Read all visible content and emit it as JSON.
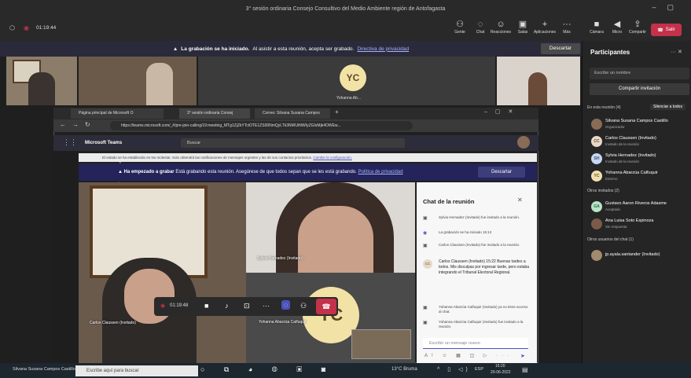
{
  "outer": {
    "window_title": "3° sesión ordinaria Consejo Consultivo del Medio Ambiente región de Antofagasta",
    "timer": "01:19:44",
    "toolbar": [
      {
        "label": "Gente",
        "icon": "people-icon"
      },
      {
        "label": "Chat",
        "icon": "chat-icon"
      },
      {
        "label": "Reacciones",
        "icon": "reactions-icon"
      },
      {
        "label": "Salas",
        "icon": "rooms-icon"
      },
      {
        "label": "Aplicaciones",
        "icon": "apps-icon"
      },
      {
        "label": "Más",
        "icon": "more-icon"
      }
    ],
    "device_controls": [
      {
        "label": "Cámara",
        "icon": "camera-icon"
      },
      {
        "label": "Micro",
        "icon": "mic-icon"
      },
      {
        "label": "Compartir",
        "icon": "share-icon"
      }
    ],
    "leave_label": "Salir",
    "rec_banner": {
      "text": "La grabación se ha iniciado.",
      "detail": "Al asistir a esta reunión, acepta ser grabado.",
      "link": "Directiva de privacidad",
      "button": "Descartar"
    },
    "thumbs": [
      {
        "name": ""
      },
      {
        "name": ""
      },
      {
        "initials": "YC",
        "name": "Yohanna Ab..."
      },
      {
        "name": ""
      }
    ]
  },
  "participants": {
    "title": "Participantes",
    "search_placeholder": "Escribe un nombre",
    "share_invite": "Compartir invitación",
    "in_meeting_label": "En esta reunión (4)",
    "mute_all": "Silenciar a todos",
    "in_meeting": [
      {
        "initials": "",
        "name": "Silvana Susana Campos Castillo",
        "role": "Organizador",
        "color": "#8a6b55"
      },
      {
        "initials": "CC",
        "name": "Carlos Claussen (Invitado)",
        "role": "Invitado de la reunión",
        "color": "#e8d8c8"
      },
      {
        "initials": "SH",
        "name": "Sylvia Hernadez (Invitado)",
        "role": "Invitado de la reunión",
        "color": "#c9d6ef"
      },
      {
        "initials": "YC",
        "name": "Yohanna Abarzúa Calfuquir",
        "role": "Externo",
        "color": "#f0e0b0"
      }
    ],
    "invited_label": "Otros invitados (2)",
    "invited": [
      {
        "initials": "GA",
        "name": "Gustavo Aaron Riveros Adasme",
        "role": "Aceptado",
        "color": "#b9e3c6"
      },
      {
        "initials": "",
        "name": "Ana Luisa Soto Espinoza",
        "role": "Sin respuesta",
        "color": "#7a5a48"
      }
    ],
    "chat_users_label": "Otros usuarios del chat (1)",
    "chat_users": [
      {
        "initials": "",
        "name": "jp.ayala.santander (Invitado)",
        "role": "",
        "color": "#a08a70"
      }
    ]
  },
  "browser": {
    "tabs": [
      "Página principal de Microsoft O",
      "3° sesión ordinaria Consej",
      "Correo: Silvana Susana Campos"
    ],
    "url": "https://teams.microsoft.com/_#/pre-join-calling/19:meeting_MTg1ZjZkYTctOTE1ZS00NmQyLTk3NWUtNWIyZGIxMjk4OWEw...",
    "app_name": "Microsoft Teams",
    "search_placeholder": "Buscar",
    "dnd_text": "El estado se ha establecido en No molestar. Solo obtendrá las notificaciones de mensajes urgentes y las de sus contactos prioritarios.",
    "dnd_link": "Cambie la configuración.",
    "rec_title": "Ha empezado a grabar",
    "rec_text": "Está grabando esta reunión. Asegúrese de que todos sepan que se les está grabando.",
    "rec_link": "Política de privacidad",
    "rec_button": "Descartar"
  },
  "stage": {
    "main_name": "Carlos Claussen (Invitado)",
    "cam2_name": "Sylvia Hernadez (Invitado)",
    "cam3_name": "Yohanna Abarzúa Calfuquir",
    "cam3_initials": "YC",
    "call_timer": "01:19:48"
  },
  "chat": {
    "title": "Chat de la reunión",
    "messages": [
      {
        "icon": "person-add-icon",
        "text": "Sylvia Hernadez (Invitado) fue invitado a la reunión."
      },
      {
        "icon": "record-icon",
        "text": "La grabación se ha iniciado    15:12"
      },
      {
        "icon": "person-add-icon",
        "text": "Carlos Claussen (Invitado) fue invitado a la reunión."
      },
      {
        "icon": "avatar-cc",
        "text": "Carlos Claussen (Invitado)  15:22  Buenas tardes a todos. Mis disculpas por ingresar tarde, pero estaba integrando el Tribunal Electoral Regional."
      },
      {
        "icon": "person-add-icon",
        "text": "Yohanna Abarzúa Calfuquir (Invitado) ya no tiene acceso al chat."
      },
      {
        "icon": "person-add-icon",
        "text": "Yohanna Abarzúa Calfuquir (Invitado) fue invitado a la reunión."
      }
    ],
    "input_placeholder": "Escribir un mensaje nuevo"
  },
  "taskbar": {
    "self_label": "Silvana Susana Campos Castillo",
    "search_placeholder": "Escribe aquí para buscar",
    "weather": "13°C Bruma",
    "lang": "ESP",
    "time": "16:20",
    "date": "20-06-2022"
  },
  "colors": {
    "accent": "#4b53bc",
    "danger": "#c4314b"
  }
}
